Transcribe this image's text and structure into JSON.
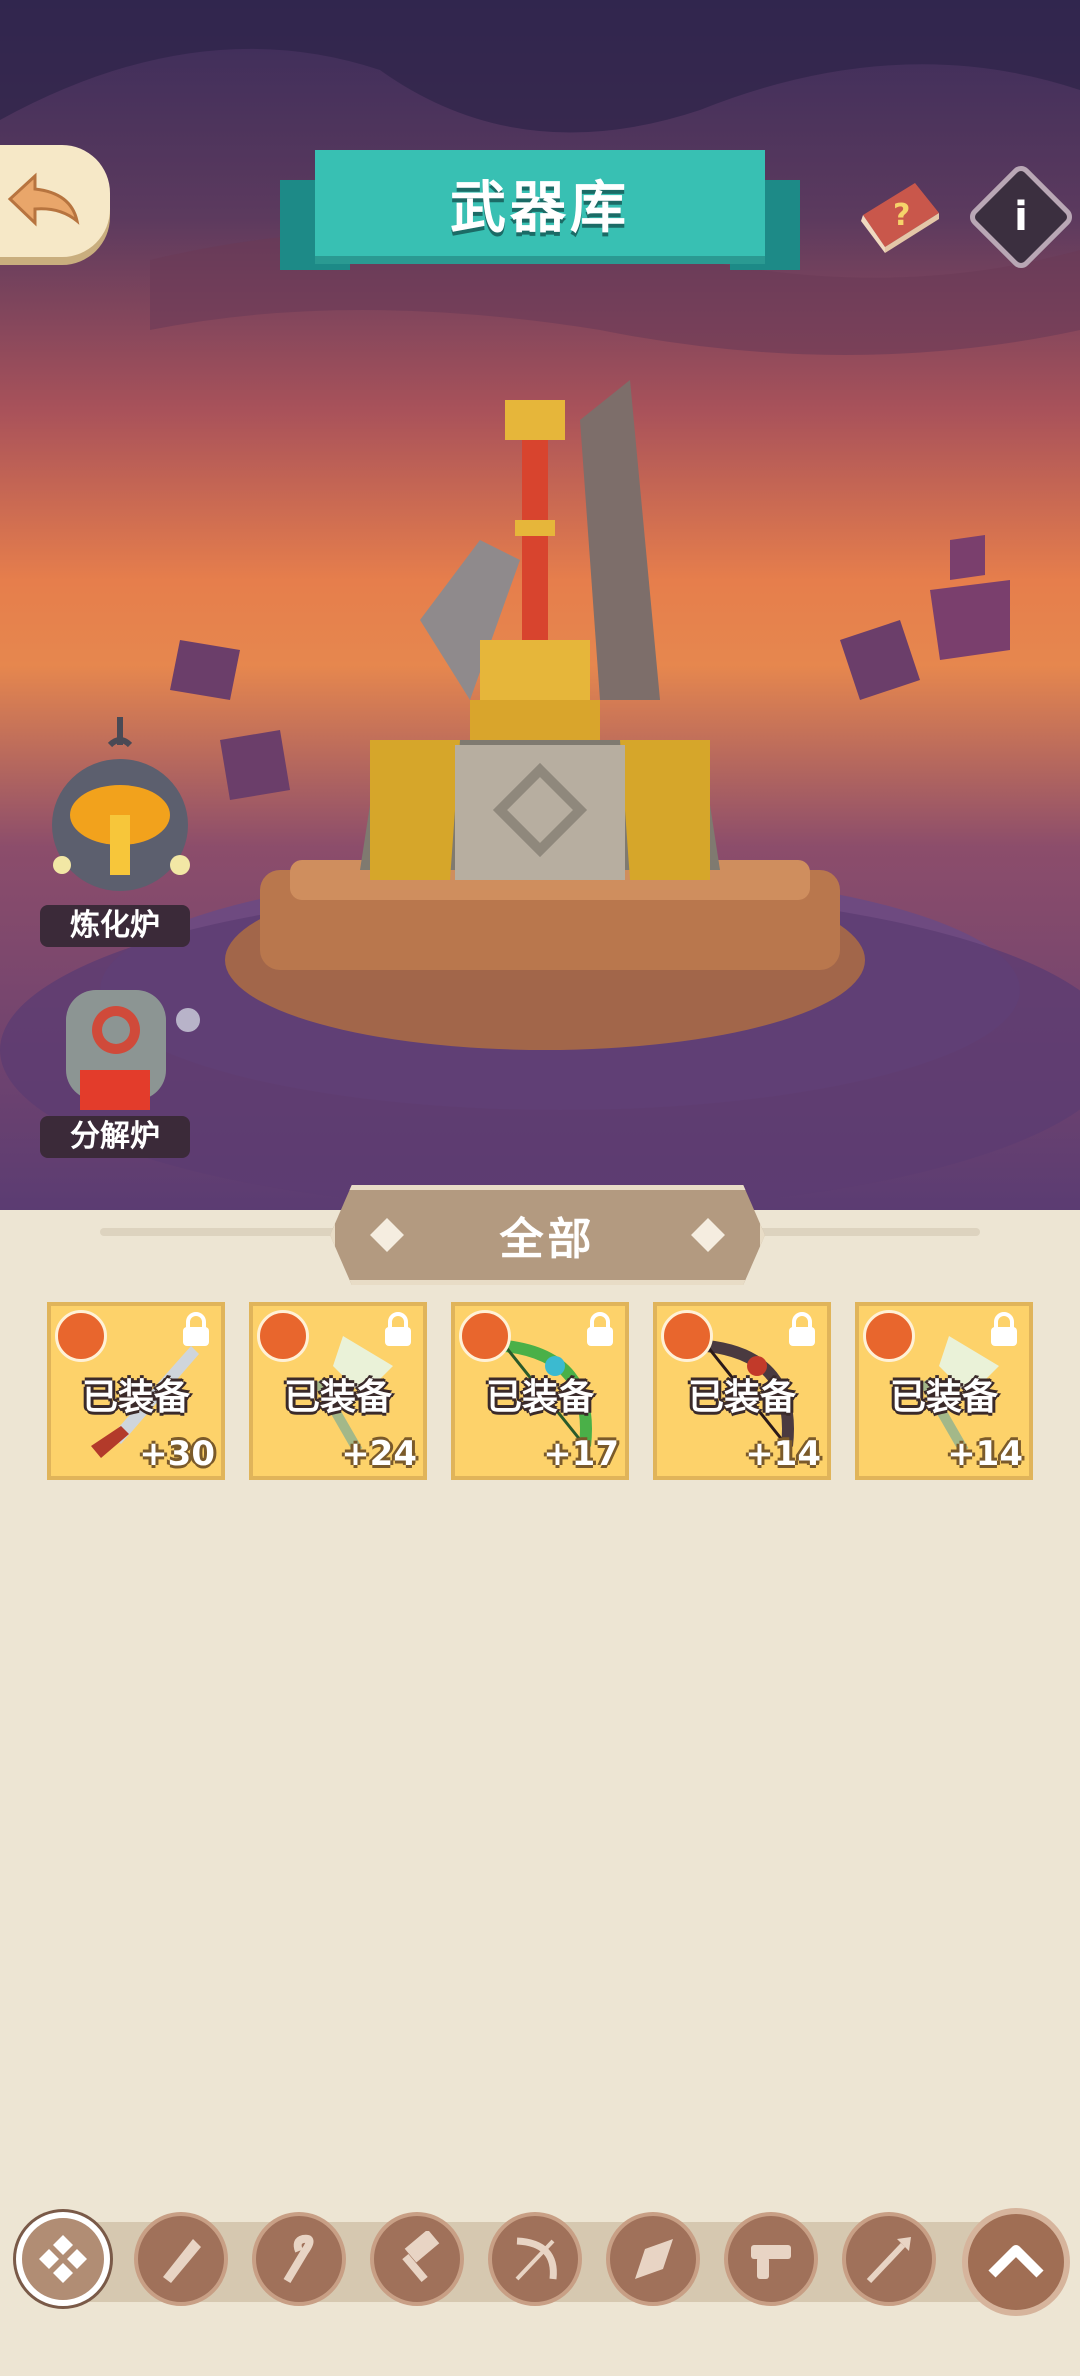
{
  "header": {
    "title": "武器库",
    "back_icon": "back-arrow-icon",
    "help_icon": "help-book-icon",
    "info_label": "i"
  },
  "stations": {
    "smelter_label": "炼化炉",
    "decomposer_label": "分解炉"
  },
  "filter": {
    "label": "全部"
  },
  "weapons": [
    {
      "status": "已装备",
      "level": "+30",
      "icon": "dagger-weapon-icon"
    },
    {
      "status": "已装备",
      "level": "+24",
      "icon": "ice-axe-weapon-icon"
    },
    {
      "status": "已装备",
      "level": "+17",
      "icon": "green-bow-weapon-icon"
    },
    {
      "status": "已装备",
      "level": "+14",
      "icon": "dark-bow-weapon-icon"
    },
    {
      "status": "已装备",
      "level": "+14",
      "icon": "ice-axe-weapon-icon"
    }
  ],
  "categories": [
    "all-category-icon",
    "sword-category-icon",
    "staff-category-icon",
    "hammer-category-icon",
    "bow-category-icon",
    "claw-category-icon",
    "gun-category-icon",
    "spear-category-icon"
  ],
  "colors": {
    "teal": "#38c0b3",
    "card": "#fdd26a",
    "panel": "#ede5d3",
    "button": "#a0715a"
  }
}
